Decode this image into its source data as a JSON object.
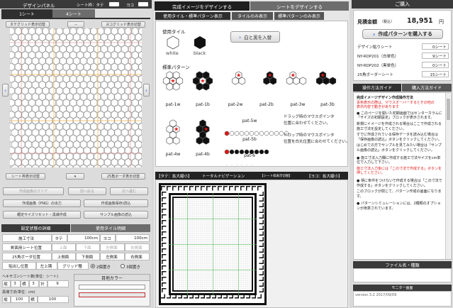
{
  "left": {
    "title": "デザインパネル",
    "sheet_toggle": "シート枠：タテ",
    "sheet_toggle_yoko": "ヨコ",
    "tabs": [
      "1シート",
      "4シート"
    ],
    "tate_grid_btn": "タテグリッド表示切替",
    "yoko_grid_btn": "ヨコグリッド表示切替",
    "dash": "－",
    "nav_left": "‹",
    "nav_right": "›",
    "sheet_tile_btn": "シート枠表示切替",
    "nav_down": "▾",
    "border_btn": "25角ボーダ表示切替",
    "clear_btn": "作成画像のクリア",
    "prev_btn": "前へ戻る",
    "next_btn": "次へ進む",
    "output_btn": "作成画像（PNG）の出力",
    "save_btn": "作成画像保存/読込",
    "reset_btn": "鋸定サイズリセット・黒縁作成",
    "sample_btn": "サンプル画像の読込",
    "tab_status": "設定状態の詳細",
    "tab_tile": "使用タイル明細",
    "rows": [
      {
        "label": "施工寸法",
        "tate_l": "タテ",
        "tate_v": "100cm",
        "yoko_l": "ヨコ",
        "yoko_v": "100cm"
      },
      {
        "label": "剣面用シート位置",
        "c1": "上面",
        "c2": "下面",
        "c3": "左側面",
        "c4": "右側面"
      },
      {
        "label": "25角ボーダ位置",
        "c1": "上側面",
        "c2": "下側面",
        "c3": "左側面",
        "c4": "右側面"
      }
    ],
    "row4": {
      "label": "貼出し位置",
      "c1": "左上隅",
      "grid_label": "グリッド種",
      "opt1": "2個置き",
      "opt2": "3個置き"
    },
    "sheet_count_label": "ヘキサゴンシート数(単位：シート)",
    "sheet_counts": {
      "tate_l": "縦",
      "tate_v": "3",
      "yoko_l": "横",
      "yoko_v": "3",
      "total_l": "計",
      "total_v": "9"
    },
    "area_label": "黒塊寸法(単位：cm)",
    "area": {
      "tate_l": "縦",
      "tate_v": "100",
      "yoko_l": "横",
      "yoko_v": "100"
    },
    "color_title": "目地カラー"
  },
  "middle": {
    "tab_active": "完成イメージをデザインする",
    "tab_other": "シートをデザインする",
    "subtabs": [
      "使用タイル・標準パターン表示",
      "タイルのみ表示",
      "標準パターンのみ表示"
    ],
    "tile_section": "使用タイル",
    "tile_white": "white",
    "tile_black": "black",
    "swap_btn": "白と黒を入替",
    "pattern_section": "標準パターン",
    "patterns": [
      "pat-1w",
      "pat-1b",
      "pat-2w",
      "pat-2b",
      "pat-3w",
      "pat-3b",
      "pat-4w",
      "pat-4b",
      "pat-5w",
      "pat-5b",
      "pat-6"
    ],
    "drag_note_1": "ドラッグ時のマウスポインタ",
    "drag_note_2": "位置に合わせてください。",
    "drop_note_1": "ドロップ時のマウスポインタ",
    "drop_note_2": "位置を白丸位置に合わせてください。",
    "preview_header_left": "【タテ：拡大縮小】",
    "preview_header_mid": "トータルナビゲーション",
    "preview_header_tag": "【シート枠表示切替】",
    "preview_header_right": "【ヨコ：拡大縮小】"
  },
  "right": {
    "title": "ご購入",
    "price_label": "見積金額",
    "price_tax": "（税込）",
    "price_value": "18,951",
    "price_unit": "円",
    "purchase_btn": "作成パターンを購入する",
    "items": [
      {
        "name": "デザイン貼りシート",
        "qty": "0シート"
      },
      {
        "name": "NY-RDP201（白単色）",
        "qty": "9シート"
      },
      {
        "name": "NY-RDP202（黒単色）",
        "qty": "0シート"
      },
      {
        "name": "25角ボーダーシート",
        "qty": "15シート"
      }
    ],
    "guide_tab_1": "操作方法ガイド",
    "guide_tab_2": "購入方法ガイド",
    "guide_title": "完成イメージデザイン作成操作方法",
    "guide_red_1": "青色表示の際は、マウスオーバーするとその他の",
    "guide_red_2": "表示内容で動きがあります",
    "guide_p1": "● このページを開いた初期画面ではセンターカラムに「サイズの初期設定」ブロックが表示されます。",
    "guide_p2": "新規にイメージを作成される場合はここで作成される施工寸法を設定してください。",
    "guide_p3": "すでに作成されている保存データを読み込む場合は「保存画像の読込」ボタンをクリックしてください。",
    "guide_p4": "はじめての方でサンプルを見てみたい場合は「サンプル画像の読込」ボタンをクリックしてください。",
    "guide_p5": "● 施工寸法入力欄に作成する施工寸法サイズをcm単位で入力して下さい。",
    "guide_p6": "施工寸法入力後には「この寸法で作成する」ボタンを押してください。",
    "guide_p7": "● 柄に条件をつけないで作成する場合は「この寸法で作成する」ボタンをクリックしてください。",
    "guide_p8": "このブロックが閉じて、パターン作成の画面になります。",
    "guide_p9": "● パターンシミュレーションには、2種類のオプションが用意されています。",
    "file_title": "ファイル名・種類",
    "monitor_title": "モニター画面",
    "version": "version.3.2 2017/09/09"
  },
  "colors": {
    "dark": "#3a3a3a",
    "accent_blue": "#2a6fd0",
    "red": "#e01818",
    "grid_orange": "#f2b24a",
    "grid_green": "#5fbf5f",
    "grid_purple": "#b088d8"
  }
}
